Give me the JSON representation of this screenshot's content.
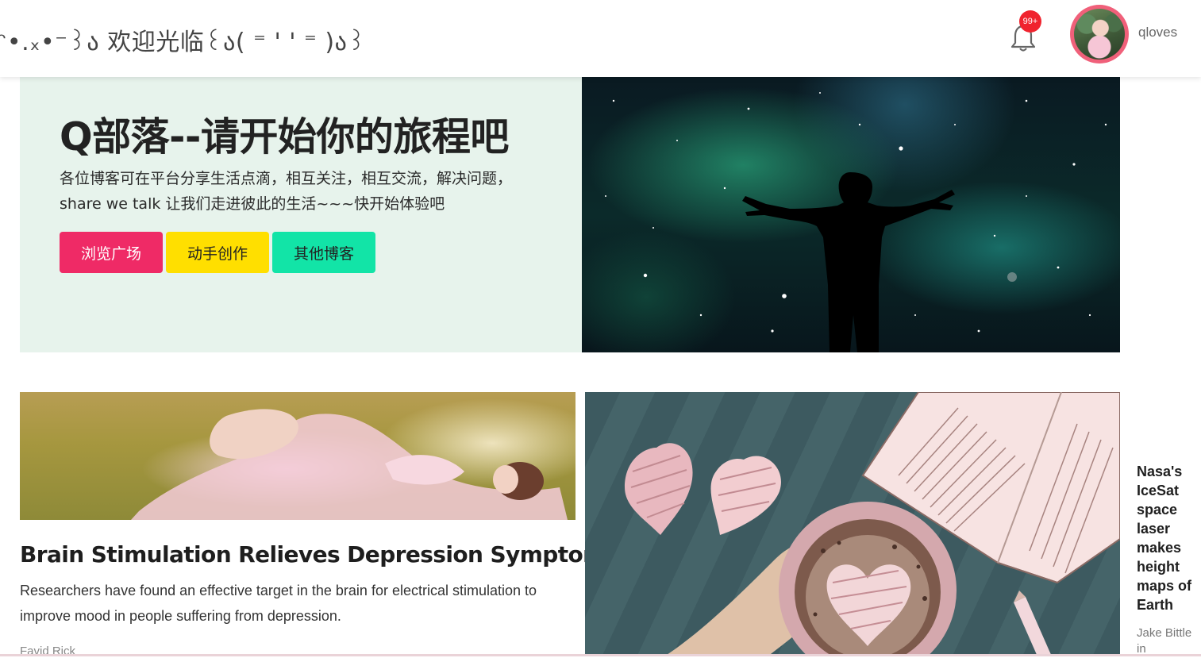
{
  "header": {
    "welcome_text": "ᵔ•.ₓ•⁻꒱ა 欢迎光临꒰ა( ⁼ ' ' ⁼ )ა꒱",
    "notification_badge": "99+",
    "username": "qloves",
    "icons": {
      "notification": "bell-icon",
      "avatar": "user-avatar"
    }
  },
  "hero": {
    "title": "Q部落--请开始你的旅程吧",
    "description": "各位博客可在平台分享生活点滴，相互关注，相互交流，解决问题，share we talk 让我们走进彼此的生活~~~快开始体验吧",
    "buttons": {
      "browse": "浏览广场",
      "create": "动手创作",
      "other": "其他博客"
    },
    "colors": {
      "panel_bg": "#e7f3ec",
      "browse": "#ef2a66",
      "create": "#ffdf00",
      "other": "#12e4a7"
    }
  },
  "articles": {
    "featured": {
      "title": "Brain Stimulation Relieves Depression Symptoms",
      "description": "Researchers have found an effective target in the brain for electrical stimulation to improve mood in people suffering from depression.",
      "author": "Favid Rick"
    },
    "side": {
      "title": "Nasa's IceSat space laser makes height maps of Earth",
      "author": "Jake Bittle in"
    }
  },
  "colors": {
    "badge": "#f0232e",
    "avatar_ring": "#f0607a"
  }
}
